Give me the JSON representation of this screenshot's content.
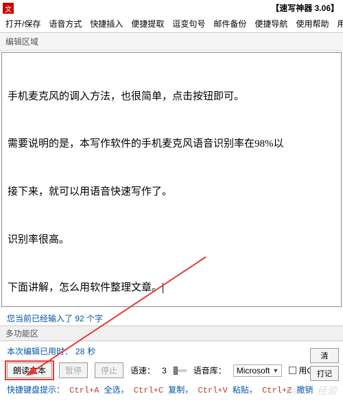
{
  "title": "【速写神器 3.06】",
  "logo": "文",
  "menu": [
    "打开/保存",
    "语音方式",
    "快捷插入",
    "便捷提取",
    "逗变句号",
    "邮件备份",
    "便捷导航",
    "使用帮助",
    "用户中心"
  ],
  "editor_label": "编辑区域",
  "editor_lines": [
    "手机麦克风的调入方法，也很简单，点击按钮即可。",
    "需要说明的是，本写作软件的手机麦克风语音识别率在98%以",
    "接下来，就可以用语音快速写作了。",
    "识别率很高。",
    "下面讲解，怎么用软件整理文章。"
  ],
  "status": {
    "prefix": "您当前已经输入了 ",
    "count": "92",
    "suffix": " 个字"
  },
  "multi_label": "多功能区",
  "time": {
    "prefix": "本次编辑已用时：",
    "value": "28",
    "unit": "秒"
  },
  "side": {
    "btn1": "清",
    "btn2": "打记"
  },
  "buttons": {
    "read": "朗读文本",
    "pause": "暂停",
    "stop": "停止"
  },
  "speed_label": "语速：",
  "speed_value": "3",
  "voice_label": "语音库：",
  "voice_value": "Microsoft",
  "checkbox_label": "用Ctrl表入",
  "hint": {
    "prefix": "快捷键盘提示：",
    "k1": "Ctrl+A",
    "a1": " 全选，",
    "k2": "Ctrl+C",
    "a2": " 复制，",
    "k3": "Ctrl+V",
    "a3": " 粘贴，",
    "k4": "Ctrl+Z",
    "a4": " 撤销"
  },
  "watermark": "Baico 经验"
}
